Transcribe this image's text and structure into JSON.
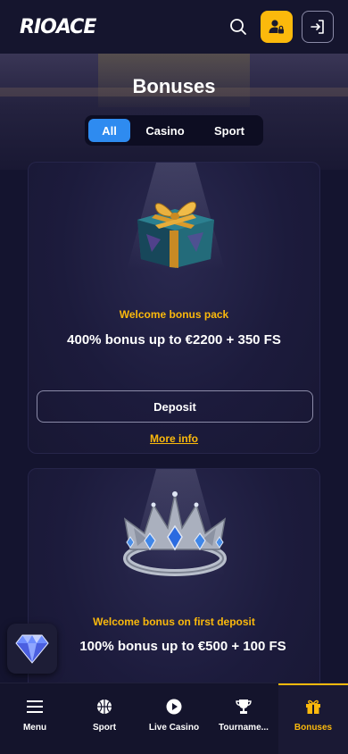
{
  "header": {
    "logo_text": "RIOACE",
    "icons": {
      "search": "search-icon",
      "user": "user-lock-icon",
      "login": "login-icon"
    },
    "colors": {
      "accent": "#fbb90c",
      "background": "#15152e"
    }
  },
  "page": {
    "title": "Bonuses"
  },
  "tabs": [
    {
      "label": "All",
      "active": true
    },
    {
      "label": "Casino",
      "active": false
    },
    {
      "label": "Sport",
      "active": false
    }
  ],
  "bonuses": [
    {
      "image": "gift-box-icon",
      "subtitle": "Welcome bonus pack",
      "title": "400% bonus up to €2200 + 350 FS",
      "button_label": "Deposit",
      "link_label": "More info"
    },
    {
      "image": "crown-icon",
      "subtitle": "Welcome bonus on first deposit",
      "title": "100% bonus up to €500 + 100 FS"
    }
  ],
  "floating_widget": {
    "icon": "diamond-icon"
  },
  "bottom_nav": [
    {
      "label": "Menu",
      "icon": "menu-icon",
      "active": false
    },
    {
      "label": "Sport",
      "icon": "basketball-icon",
      "active": false
    },
    {
      "label": "Live Casino",
      "icon": "play-icon",
      "active": false
    },
    {
      "label": "Tourname...",
      "icon": "trophy-icon",
      "active": false
    },
    {
      "label": "Bonuses",
      "icon": "gift-icon",
      "active": true
    }
  ]
}
